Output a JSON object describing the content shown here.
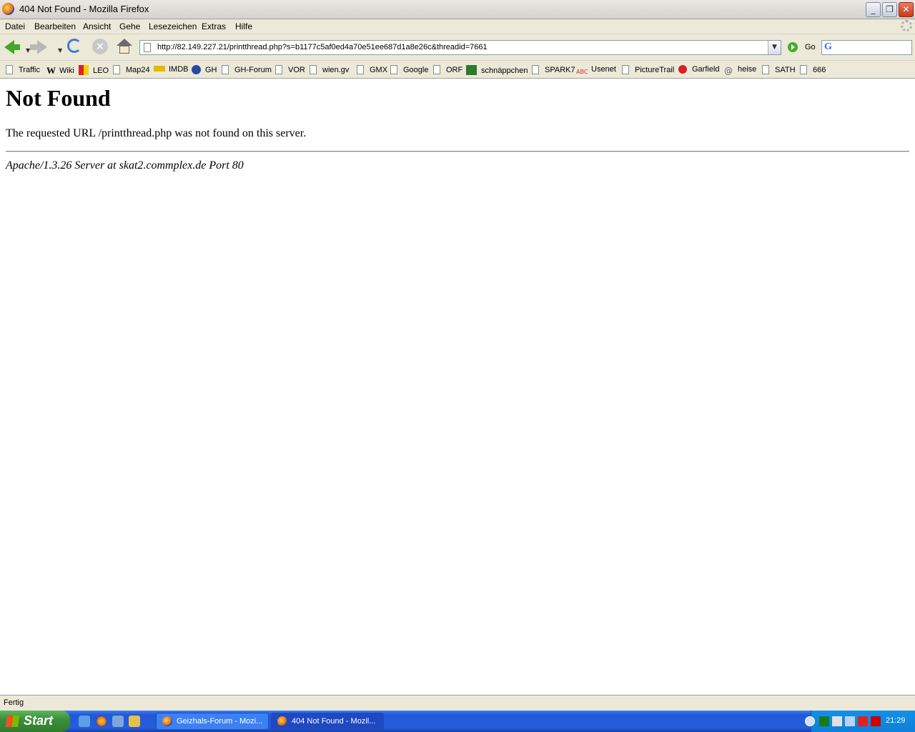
{
  "window": {
    "title": "404 Not Found - Mozilla Firefox"
  },
  "menu": [
    "Datei",
    "Bearbeiten",
    "Ansicht",
    "Gehe",
    "Lesezeichen",
    "Extras",
    "Hilfe"
  ],
  "nav": {
    "url": "http://82.149.227.21/printthread.php?s=b1177c5af0ed4a70e51ee687d1a8e26c&threadid=7661",
    "go_label": "Go"
  },
  "bookmarks": [
    "Traffic",
    "Wiki",
    "LEO",
    "Map24",
    "IMDB",
    "GH",
    "GH-Forum",
    "VOR",
    "wien.gv",
    "GMX",
    "Google",
    "ORF",
    "schnäppchen",
    "SPARK7",
    "Usenet",
    "PictureTrail",
    "Garfield",
    "heise",
    "SATH",
    "666"
  ],
  "page": {
    "heading": "Not Found",
    "message": "The requested URL /printthread.php was not found on this server.",
    "address": "Apache/1.3.26 Server at skat2.commplex.de Port 80"
  },
  "status": "Fertig",
  "taskbar": {
    "start": "Start",
    "tasks": [
      "Geizhals-Forum - Mozi...",
      "404 Not Found - Mozil..."
    ],
    "clock": "21:29"
  }
}
